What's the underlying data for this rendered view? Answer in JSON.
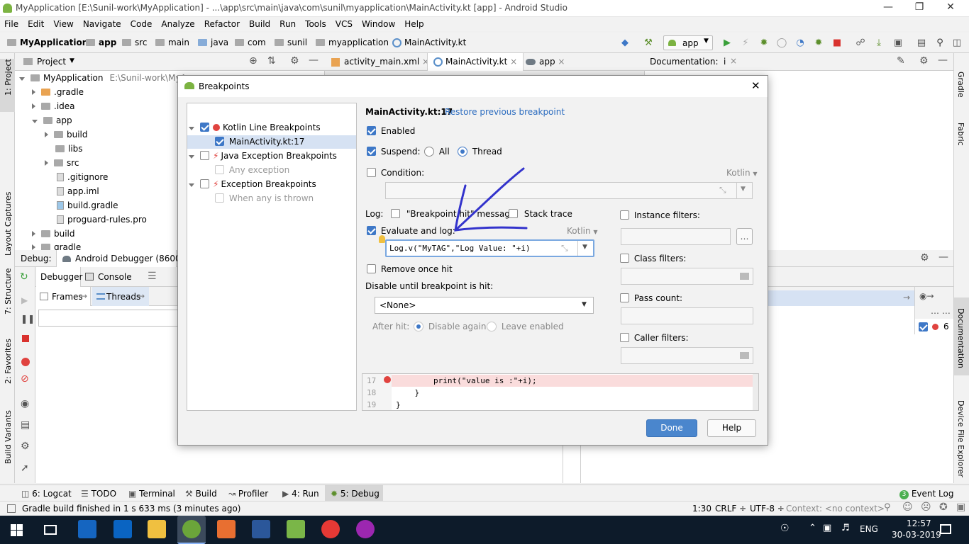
{
  "window": {
    "title": "MyApplication [E:\\Sunil-work\\MyApplication] - ...\\app\\src\\main\\java\\com\\sunil\\myapplication\\MainActivity.kt [app] - Android Studio"
  },
  "menu": [
    "File",
    "Edit",
    "View",
    "Navigate",
    "Code",
    "Analyze",
    "Refactor",
    "Build",
    "Run",
    "Tools",
    "VCS",
    "Window",
    "Help"
  ],
  "breadcrumb": [
    "MyApplication",
    "app",
    "src",
    "main",
    "java",
    "com",
    "sunil",
    "myapplication",
    "MainActivity.kt"
  ],
  "run_config": "app",
  "project": {
    "header": "Project",
    "root_name": "MyApplication",
    "root_path": "E:\\Sunil-work\\MyA",
    "items": [
      ".gradle",
      ".idea",
      "app",
      "build",
      "libs",
      "src",
      ".gitignore",
      "app.iml",
      "build.gradle",
      "proguard-rules.pro",
      "build",
      "gradle"
    ]
  },
  "editor_tabs": [
    "activity_main.xml",
    "MainActivity.kt",
    "app"
  ],
  "doc_panel": {
    "title": "Documentation:",
    "tab": "i"
  },
  "left_tools": [
    "1: Project",
    "Layout Captures",
    "7: Structure",
    "2: Favorites",
    "Build Variants"
  ],
  "right_tools": [
    "Gradle",
    "Fabric",
    "Documentation",
    "Device File Explorer"
  ],
  "debug": {
    "label": "Debug:",
    "session": "Android Debugger (8600)",
    "tabs": [
      "Debugger",
      "Console"
    ],
    "frames_tab": "Frames",
    "threads_tab": "Threads",
    "right_num": "6"
  },
  "dialog": {
    "title": "Breakpoints",
    "tree": {
      "kotlin_group": "Kotlin Line Breakpoints",
      "kotlin_item": "MainActivity.kt:17",
      "java_group": "Java Exception Breakpoints",
      "java_item": "Any exception",
      "exc_group": "Exception Breakpoints",
      "exc_item": "When any is thrown"
    },
    "header_title": "MainActivity.kt:17",
    "restore_link": "Restore previous breakpoint",
    "enabled": "Enabled",
    "suspend": "Suspend:",
    "all": "All",
    "thread": "Thread",
    "condition": "Condition:",
    "kotlin_lang": "Kotlin",
    "log": "Log:",
    "breakpoint_hit": "\"Breakpoint hit\" message",
    "stack_trace": "Stack trace",
    "evaluate_log": "Evaluate and log:",
    "evaluate_expr": "Log.v(\"MyTAG\",\"Log Value: \"+i)",
    "remove_once": "Remove once hit",
    "disable_until": "Disable until breakpoint is hit:",
    "none_option": "<None>",
    "after_hit": "After hit:",
    "disable_again": "Disable again",
    "leave_enabled": "Leave enabled",
    "instance_filters": "Instance filters:",
    "class_filters": "Class filters:",
    "pass_count": "Pass count:",
    "caller_filters": "Caller filters:",
    "done": "Done",
    "help": "Help",
    "code_lines": [
      {
        "num": "17",
        "text": "        print(\"value is :\"+i);"
      },
      {
        "num": "18",
        "text": "    }"
      },
      {
        "num": "19",
        "text": "}"
      }
    ]
  },
  "bottom_tabs": [
    "6: Logcat",
    "TODO",
    "Terminal",
    "Build",
    "Profiler",
    "4: Run",
    "5: Debug"
  ],
  "event_log": {
    "count": "3",
    "label": "Event Log"
  },
  "status": {
    "message": "Gradle build finished in 1 s 633 ms (3 minutes ago)",
    "position": "1:30",
    "line_sep": "CRLF ÷",
    "encoding": "UTF-8 ÷",
    "context": "Context: <no context>"
  },
  "taskbar": {
    "lang": "ENG",
    "time": "12:57",
    "date": "30-03-2019"
  },
  "colors": {
    "accent": "#3e78c7",
    "breakpoint_red": "#e0433f",
    "annotation_arrow": "#3333cc",
    "taskbar": "#0d1b2a"
  }
}
